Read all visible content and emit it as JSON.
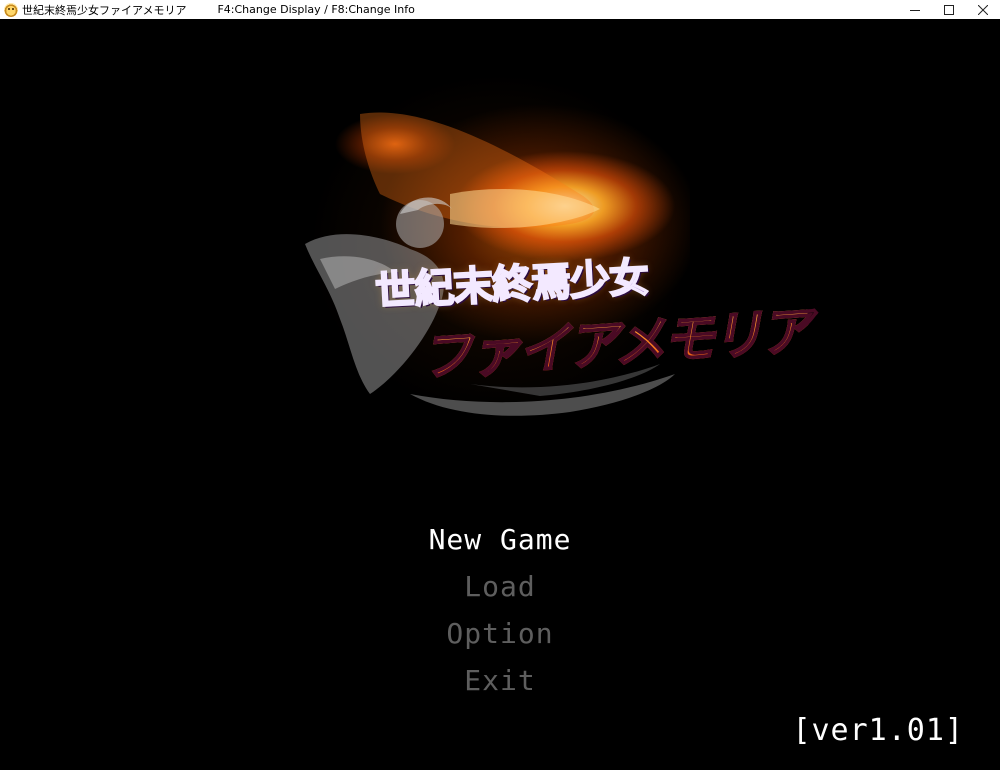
{
  "window": {
    "title": "世紀末終焉少女ファイアメモリア",
    "hint": "F4:Change Display / F8:Change Info",
    "controls": {
      "minimize": "—",
      "maximize": "☐",
      "close": "✕"
    }
  },
  "logo": {
    "line1": "世紀末終焉少女",
    "line2": "ファイアメモリア"
  },
  "menu": {
    "items": [
      {
        "label": "New Game",
        "selected": true
      },
      {
        "label": "Load",
        "selected": false
      },
      {
        "label": "Option",
        "selected": false
      },
      {
        "label": "Exit",
        "selected": false
      }
    ]
  },
  "version": "[ver1.01]",
  "colors": {
    "background": "#000000",
    "menu_selected": "#ffffff",
    "menu_inactive": "#5e5e5e",
    "titlebar": "#ffffff"
  }
}
